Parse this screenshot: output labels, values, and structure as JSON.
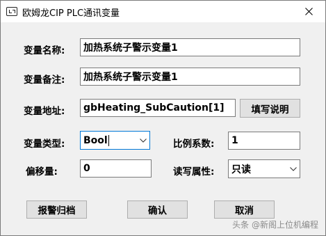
{
  "window": {
    "title": "欧姆龙CIP PLC通讯变量"
  },
  "form": {
    "name_label": "变量名称:",
    "name_value": "加热系统子警示变量1",
    "note_label": "变量备注:",
    "note_value": "加热系统子警示变量1",
    "address_label": "变量地址:",
    "address_value": "gbHeating_SubCaution[1]",
    "fill_help_button": "填写说明",
    "type_label": "变量类型:",
    "type_value": "Bool",
    "scale_label": "比例系数:",
    "scale_value": "1",
    "offset_label": "偏移量:",
    "offset_value": "0",
    "rw_label": "读写属性:",
    "rw_value": "只读"
  },
  "buttons": {
    "alarm_group": "报警归档",
    "confirm": "确认",
    "cancel": "取消"
  },
  "watermark": "头条 @新阁上位机编程"
}
